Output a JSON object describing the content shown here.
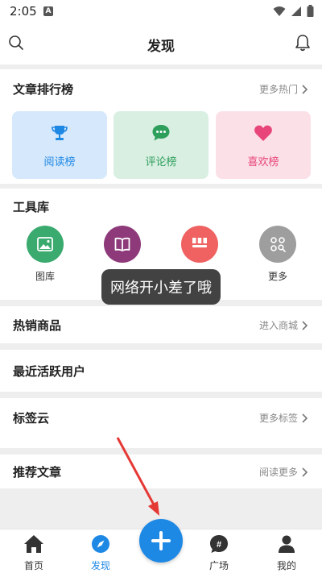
{
  "status_bar": {
    "time": "2:05",
    "indicator": "A"
  },
  "header": {
    "title": "发现"
  },
  "ranking": {
    "title": "文章排行榜",
    "more": "更多热门",
    "cards": [
      {
        "label": "阅读榜",
        "icon": "trophy-icon",
        "color": "#1e88e5",
        "bg": "#d6e8fb"
      },
      {
        "label": "评论榜",
        "icon": "chat-icon",
        "color": "#2e9e5b",
        "bg": "#d8efe2"
      },
      {
        "label": "喜欢榜",
        "icon": "heart-icon",
        "color": "#e8457a",
        "bg": "#fbe0e8"
      }
    ]
  },
  "tools": {
    "title": "工具库",
    "items": [
      {
        "label": "图库",
        "icon": "image-icon",
        "color": "#3aaa6e"
      },
      {
        "label": "",
        "icon": "book-icon",
        "color": "#8e3a7a"
      },
      {
        "label": "",
        "icon": "grid-icon",
        "color": "#f06262"
      },
      {
        "label": "更多",
        "icon": "apps-icon",
        "color": "#9e9e9e"
      }
    ]
  },
  "toast": {
    "text": "网络开小差了哦"
  },
  "hot_goods": {
    "title": "热销商品",
    "more": "进入商城"
  },
  "active_users": {
    "title": "最近活跃用户"
  },
  "tags": {
    "title": "标签云",
    "more": "更多标签"
  },
  "recommend": {
    "title": "推荐文章",
    "more": "阅读更多"
  },
  "bottom_nav": {
    "items": [
      {
        "label": "首页",
        "icon": "home-icon"
      },
      {
        "label": "发现",
        "icon": "compass-icon",
        "active": true
      },
      {
        "label": "广场",
        "icon": "hashtag-icon"
      },
      {
        "label": "我的",
        "icon": "person-icon"
      }
    ],
    "fab_icon": "plus-icon"
  },
  "colors": {
    "accent": "#1e88e5",
    "arrow": "#e53935"
  }
}
